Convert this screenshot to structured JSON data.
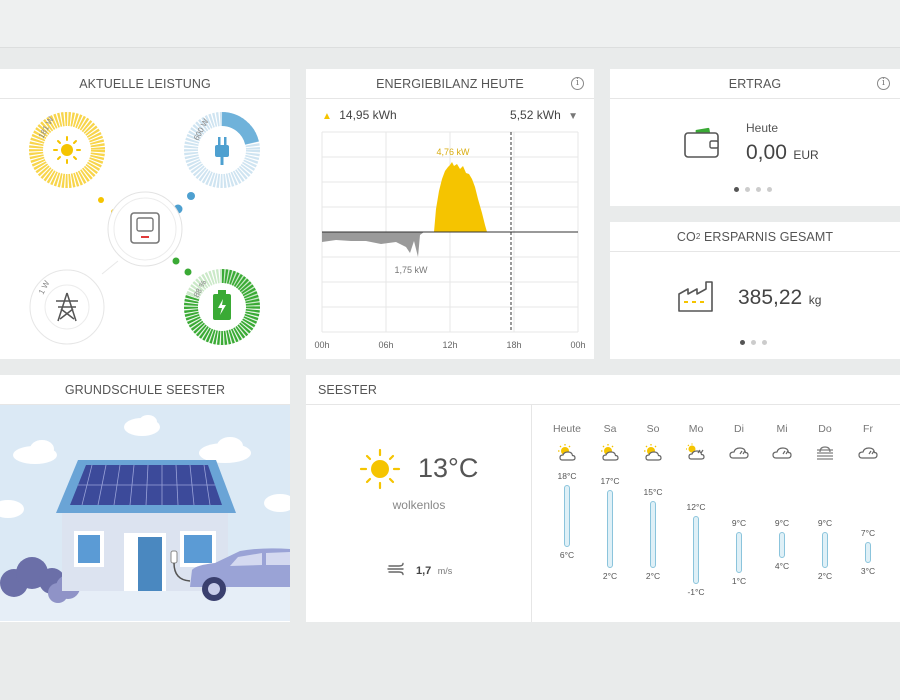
{
  "power_card": {
    "title": "AKTUELLE LEISTUNG",
    "solar_value": "181 W",
    "consumption_value": "600 W",
    "grid_value": "1 W",
    "battery_value": "88 %",
    "colors": {
      "solar": "#f5c400",
      "consumption": "#4ea0d0",
      "battery": "#3aaa35",
      "grid": "#888888"
    }
  },
  "balance_card": {
    "title": "ENERGIEBILANZ HEUTE",
    "produced": "14,95 kWh",
    "consumed": "5,52 kWh",
    "peak_label": "4,76 kW",
    "low_label": "1,75 kW",
    "x_ticks": [
      "00h",
      "06h",
      "12h",
      "18h",
      "00h"
    ]
  },
  "ertrag_card": {
    "title": "ERTRAG",
    "period": "Heute",
    "value": "0,00",
    "unit": "EUR"
  },
  "co2_card": {
    "title_prefix": "CO",
    "title_sub": "2",
    "title_suffix": " ERSPARNIS GESAMT",
    "value": "385,22",
    "unit": "kg"
  },
  "school_card": {
    "title": "GRUNDSCHULE SEESTER"
  },
  "weather_card": {
    "title": "SEESTER",
    "temperature": "13°C",
    "condition": "wolkenlos",
    "wind_value": "1,7",
    "wind_unit": "m/s",
    "days": [
      {
        "day": "Heute",
        "high": "18°C",
        "low": "6°C",
        "icon": "sun-cloud-icon",
        "hi": 18,
        "lo": 6
      },
      {
        "day": "Sa",
        "high": "17°C",
        "low": "2°C",
        "icon": "sun-cloud-icon",
        "hi": 17,
        "lo": 2
      },
      {
        "day": "So",
        "high": "15°C",
        "low": "2°C",
        "icon": "sun-cloud-icon",
        "hi": 15,
        "lo": 2
      },
      {
        "day": "Mo",
        "high": "12°C",
        "low": "-1°C",
        "icon": "sun-cloud-rain-icon",
        "hi": 12,
        "lo": -1
      },
      {
        "day": "Di",
        "high": "9°C",
        "low": "1°C",
        "icon": "cloud-rain-icon",
        "hi": 9,
        "lo": 1
      },
      {
        "day": "Mi",
        "high": "9°C",
        "low": "4°C",
        "icon": "cloud-rain-icon",
        "hi": 9,
        "lo": 4
      },
      {
        "day": "Do",
        "high": "9°C",
        "low": "2°C",
        "icon": "fog-icon",
        "hi": 9,
        "lo": 2
      },
      {
        "day": "Fr",
        "high": "7°C",
        "low": "3°C",
        "icon": "cloud-rain-icon",
        "hi": 7,
        "lo": 3
      }
    ]
  }
}
